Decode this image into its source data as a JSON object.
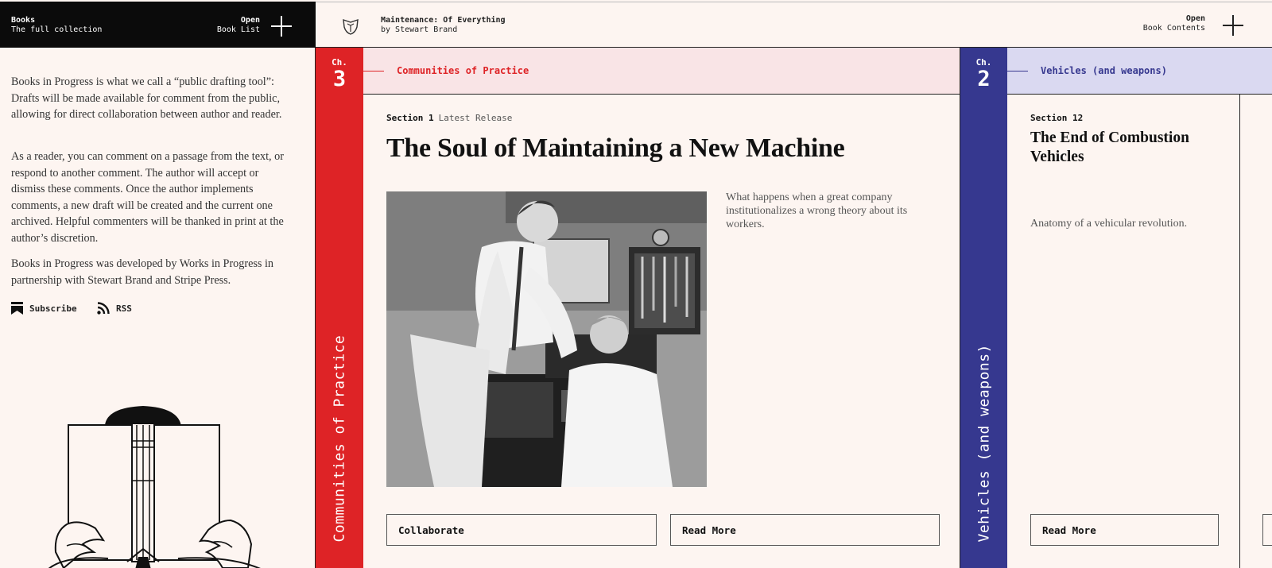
{
  "topbar": {
    "books_label": "Books",
    "collection_label": "The full collection",
    "open_label": "Open",
    "book_list_label": "Book List",
    "book_title": "Maintenance: Of Everything",
    "book_author": "by Stewart Brand",
    "open_contents_label": "Open",
    "book_contents_label": "Book Contents"
  },
  "sidebar": {
    "para1": "Books in Progress is what we call a “public drafting tool”: Drafts will be made available for comment from the public, allowing for direct collaboration between author and reader.",
    "para2": "As a reader, you can comment on a passage from the text, or respond to another comment. The author will accept or dismiss these comments. Once the author implements comments, a new draft will be created and the current one archived. Helpful commenters will be thanked in print at the author’s discretion.",
    "para3": "Books in Progress was developed by Works in Progress in partnership with Stewart Brand and Stripe Press.",
    "subscribe_label": "Subscribe",
    "rss_label": "RSS"
  },
  "chapters": [
    {
      "ch_label": "Ch.",
      "number": "3",
      "title": "Communities of Practice",
      "color": "#de2326",
      "band_color": "#f9e4e6",
      "section": {
        "label": "Section 1",
        "tag": "Latest Release",
        "title": "The Soul of Maintaining a New Machine",
        "summary": "What happens when a great company institutionalizes a wrong theory about its workers.",
        "collaborate_label": "Collaborate",
        "read_more_label": "Read More"
      }
    },
    {
      "ch_label": "Ch.",
      "number": "2",
      "title": "Vehicles (and weapons)",
      "color": "#36388f",
      "band_color": "#dad9f1",
      "section": {
        "label": "Section 12",
        "title": "The End of Combustion Vehicles",
        "summary": "Anatomy of a vehicular revolution.",
        "read_more_label": "Read More"
      }
    }
  ],
  "icons": {
    "book_logo": "shield-book-icon",
    "open_list": "plus-icon",
    "open_contents": "plus-icon",
    "subscribe": "bookmark-icon",
    "rss": "rss-icon"
  }
}
